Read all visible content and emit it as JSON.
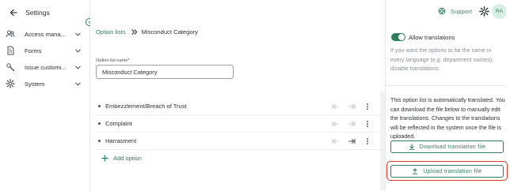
{
  "sidebar": {
    "title": "Settings",
    "items": [
      {
        "label": "Access mana...",
        "icon": "users-icon"
      },
      {
        "label": "Forms",
        "icon": "document-icon"
      },
      {
        "label": "Issue customi...",
        "icon": "wrench-icon"
      },
      {
        "label": "System",
        "icon": "gear-icon"
      }
    ]
  },
  "breadcrumb": {
    "link": "Option lists",
    "current": "Misconduct Category"
  },
  "option_list_name": {
    "label": "Option list name*",
    "value": "Misconduct Category"
  },
  "options": [
    {
      "label": "Embezzlement/Breach of Trust"
    },
    {
      "label": "Complaint"
    },
    {
      "label": "Harrasment"
    }
  ],
  "add_option_label": "Add option",
  "header": {
    "support_label": "Support",
    "avatar_initials": "RA"
  },
  "translations": {
    "toggle_label": "Allow translations",
    "toggle_on": true,
    "help_text": "If you want the options to be the same in every language (e.g. department names), disable translations.",
    "info_text": "This option list is automatically translated. You can download the file below to manually edit the translations. Changes to the translations will be reflected in the system once the file is uploaded.",
    "download_label": "Download translation file",
    "upload_label": "Upload translation file"
  },
  "colors": {
    "accent": "#2e7d5b",
    "highlight": "#e0382b",
    "avatar_bg": "#d7efe3"
  }
}
